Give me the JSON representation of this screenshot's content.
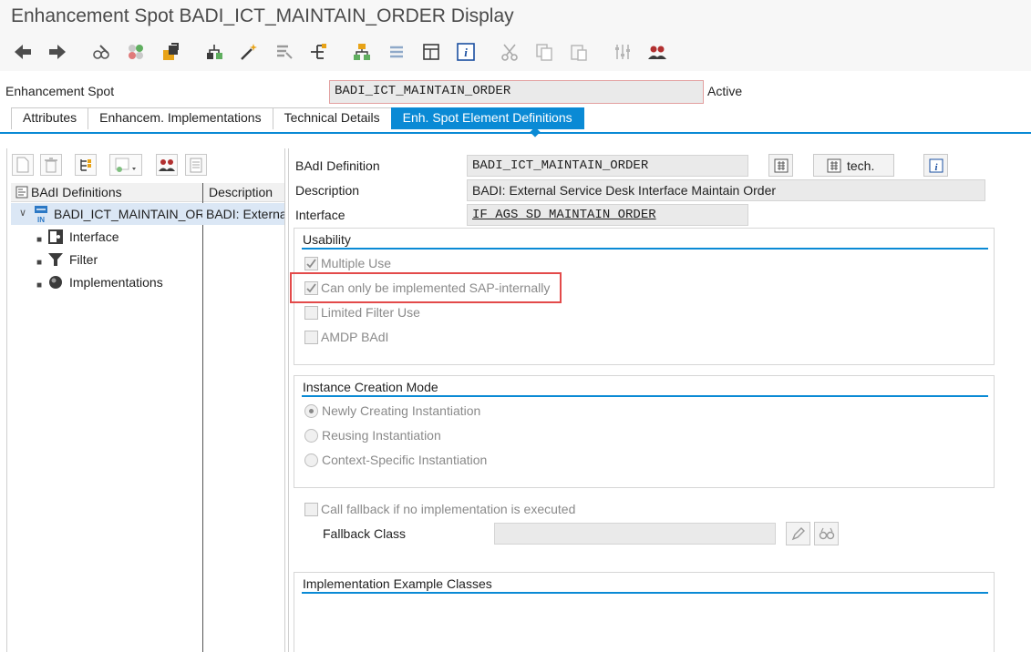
{
  "window": {
    "title": "Enhancement Spot BADI_ICT_MAINTAIN_ORDER Display"
  },
  "toolbar": {
    "icons": [
      "back-icon",
      "forward-icon",
      "display-change-icon",
      "other-object-icon",
      "activate-icon",
      "hierarchy-icon",
      "magic-wand-icon",
      "where-used-icon",
      "navigate-icon",
      "object-list-icon",
      "stack-icon",
      "display-object-icon",
      "info-icon",
      "cut-icon",
      "copy-icon",
      "paste-icon",
      "settings-icon",
      "users-icon"
    ]
  },
  "header": {
    "enhancement_spot_label": "Enhancement Spot",
    "enhancement_spot_value": "BADI_ICT_MAINTAIN_ORDER",
    "status": "Active"
  },
  "tabs": [
    {
      "label": "Attributes",
      "active": false
    },
    {
      "label": "Enhancem. Implementations",
      "active": false
    },
    {
      "label": "Technical Details",
      "active": false
    },
    {
      "label": "Enh. Spot Element Definitions",
      "active": true
    }
  ],
  "tree": {
    "col_definitions": "BAdI Definitions",
    "col_description": "Description",
    "root_name": "BADI_ICT_MAINTAIN_ORDER",
    "root_desc": "BADI: External Service Desk Interface Maintain Order",
    "children": [
      "Interface",
      "Filter",
      "Implementations"
    ]
  },
  "detail": {
    "badi_definition_label": "BAdI Definition",
    "badi_definition_value": "BADI_ICT_MAINTAIN_ORDER",
    "description_label": "Description",
    "description_value": "BADI: External Service Desk Interface Maintain Order",
    "interface_label": "Interface",
    "interface_value": "IF_AGS_SD_MAINTAIN_ORDER",
    "tech_button": "tech."
  },
  "usability": {
    "title": "Usability",
    "options": [
      {
        "label": "Multiple Use",
        "checked": true
      },
      {
        "label": "Can only be implemented SAP-internally",
        "checked": true
      },
      {
        "label": "Limited Filter Use",
        "checked": false
      },
      {
        "label": "AMDP BAdI",
        "checked": false
      }
    ]
  },
  "instance_creation": {
    "title": "Instance Creation Mode",
    "options": [
      {
        "label": "Newly Creating Instantiation",
        "selected": true
      },
      {
        "label": "Reusing Instantiation",
        "selected": false
      },
      {
        "label": "Context-Specific Instantiation",
        "selected": false
      }
    ]
  },
  "fallback": {
    "checkbox_label": "Call fallback if no implementation is executed",
    "checked": false,
    "class_label": "Fallback Class",
    "class_value": ""
  },
  "examples": {
    "title": "Implementation Example Classes"
  },
  "colors": {
    "accent": "#0a8ad5",
    "highlight": "#e34a4a",
    "field_bg": "#eaeaea"
  }
}
